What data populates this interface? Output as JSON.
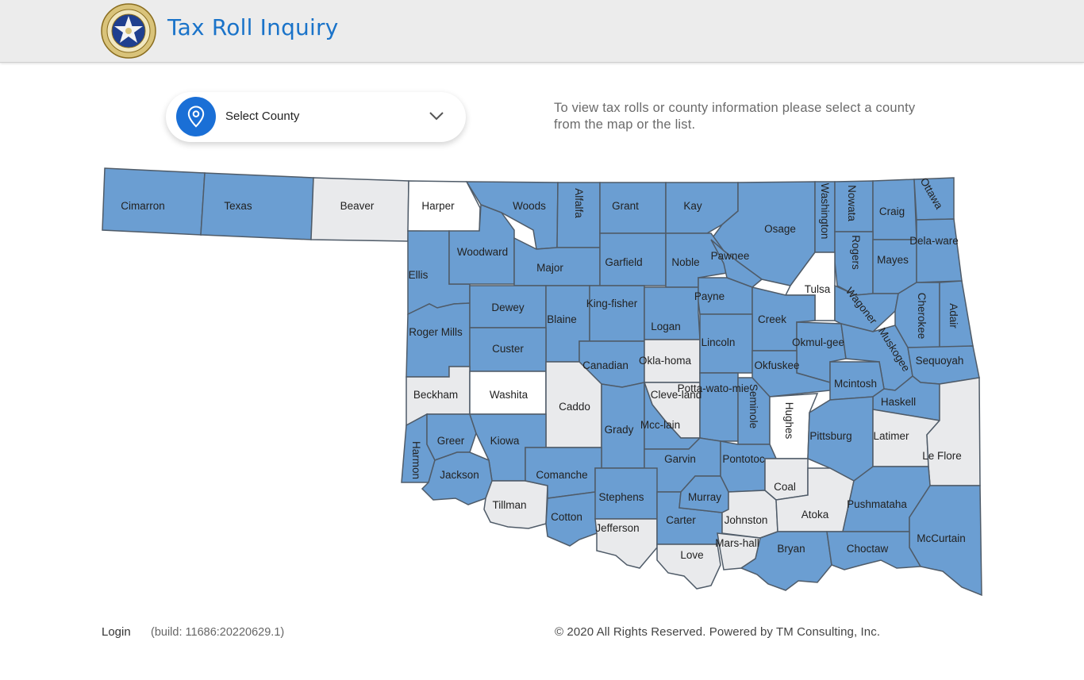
{
  "header": {
    "title": "Tax Roll Inquiry",
    "seal_icon": "state-seal-icon"
  },
  "county_select": {
    "label": "Select County",
    "icon": "map-pin-icon",
    "chevron_icon": "chevron-down-icon"
  },
  "instructions": {
    "line1": "To view tax rolls or county information please select a county",
    "line2": "from the map or the list."
  },
  "colors": {
    "accent": "#1a73c9",
    "county_available": "#6b9ed2",
    "county_unavailable": "#e9eaec",
    "county_selected_white": "#ffffff",
    "county_border": "#4f5b68"
  },
  "counties": [
    {
      "id": "cimarron",
      "name": "Cimarron"
    },
    {
      "id": "texas",
      "name": "Texas"
    },
    {
      "id": "beaver",
      "name": "Beaver"
    },
    {
      "id": "harper",
      "name": "Harper"
    },
    {
      "id": "woods",
      "name": "Woods"
    },
    {
      "id": "alfalfa",
      "name": "Alfalfa"
    },
    {
      "id": "grant",
      "name": "Grant"
    },
    {
      "id": "kay",
      "name": "Kay"
    },
    {
      "id": "osage",
      "name": "Osage"
    },
    {
      "id": "washington",
      "name": "Washington"
    },
    {
      "id": "nowata",
      "name": "Nowata"
    },
    {
      "id": "craig",
      "name": "Craig"
    },
    {
      "id": "ottawa",
      "name": "Ottawa"
    },
    {
      "id": "ellis",
      "name": "Ellis"
    },
    {
      "id": "woodward",
      "name": "Woodward"
    },
    {
      "id": "major",
      "name": "Major"
    },
    {
      "id": "garfield",
      "name": "Garfield"
    },
    {
      "id": "noble",
      "name": "Noble"
    },
    {
      "id": "pawnee",
      "name": "Pawnee"
    },
    {
      "id": "rogers",
      "name": "Rogers"
    },
    {
      "id": "mayes",
      "name": "Mayes"
    },
    {
      "id": "delaware",
      "name": "Dela-ware"
    },
    {
      "id": "tulsa",
      "name": "Tulsa"
    },
    {
      "id": "roger-mills",
      "name": "Roger Mills"
    },
    {
      "id": "dewey",
      "name": "Dewey"
    },
    {
      "id": "blaine",
      "name": "Blaine"
    },
    {
      "id": "kingfisher",
      "name": "King-fisher"
    },
    {
      "id": "logan",
      "name": "Logan"
    },
    {
      "id": "payne",
      "name": "Payne"
    },
    {
      "id": "creek",
      "name": "Creek"
    },
    {
      "id": "wagoner",
      "name": "Wagoner"
    },
    {
      "id": "cherokee",
      "name": "Cherokee"
    },
    {
      "id": "adair",
      "name": "Adair"
    },
    {
      "id": "custer",
      "name": "Custer"
    },
    {
      "id": "canadian",
      "name": "Canadian"
    },
    {
      "id": "oklahoma",
      "name": "Okla-homa"
    },
    {
      "id": "lincoln",
      "name": "Lincoln"
    },
    {
      "id": "okmulgee",
      "name": "Okmul-gee"
    },
    {
      "id": "okfuskee",
      "name": "Okfuskee"
    },
    {
      "id": "muskogee",
      "name": "Muskogee"
    },
    {
      "id": "sequoyah",
      "name": "Sequoyah"
    },
    {
      "id": "beckham",
      "name": "Beckham"
    },
    {
      "id": "washita",
      "name": "Washita"
    },
    {
      "id": "caddo",
      "name": "Caddo"
    },
    {
      "id": "cleveland",
      "name": "Cleve-land"
    },
    {
      "id": "pottawatomie",
      "name": "Potta-wato-mie"
    },
    {
      "id": "seminole",
      "name": "Seminole"
    },
    {
      "id": "hughes",
      "name": "Hughes"
    },
    {
      "id": "mcintosh",
      "name": "Mcintosh"
    },
    {
      "id": "haskell",
      "name": "Haskell"
    },
    {
      "id": "harmon",
      "name": "Harmon"
    },
    {
      "id": "greer",
      "name": "Greer"
    },
    {
      "id": "kiowa",
      "name": "Kiowa"
    },
    {
      "id": "grady",
      "name": "Grady"
    },
    {
      "id": "mcclain",
      "name": "Mcc-lain"
    },
    {
      "id": "garvin",
      "name": "Garvin"
    },
    {
      "id": "pontotoc",
      "name": "Pontotoc"
    },
    {
      "id": "pittsburg",
      "name": "Pittsburg"
    },
    {
      "id": "latimer",
      "name": "Latimer"
    },
    {
      "id": "le-flore",
      "name": "Le Flore"
    },
    {
      "id": "jackson",
      "name": "Jackson"
    },
    {
      "id": "tillman",
      "name": "Tillman"
    },
    {
      "id": "comanche",
      "name": "Comanche"
    },
    {
      "id": "cotton",
      "name": "Cotton"
    },
    {
      "id": "stephens",
      "name": "Stephens"
    },
    {
      "id": "jefferson",
      "name": "Jefferson"
    },
    {
      "id": "carter",
      "name": "Carter"
    },
    {
      "id": "murray",
      "name": "Murray"
    },
    {
      "id": "johnston",
      "name": "Johnston"
    },
    {
      "id": "coal",
      "name": "Coal"
    },
    {
      "id": "atoka",
      "name": "Atoka"
    },
    {
      "id": "pushmataha",
      "name": "Pushmataha"
    },
    {
      "id": "mccurtain",
      "name": "McCurtain"
    },
    {
      "id": "love",
      "name": "Love"
    },
    {
      "id": "marshall",
      "name": "Mars-hall"
    },
    {
      "id": "bryan",
      "name": "Bryan"
    },
    {
      "id": "choctaw",
      "name": "Choctaw"
    }
  ],
  "footer": {
    "login": "Login",
    "build": "(build: 11686:20220629.1)",
    "copyright": "© 2020 All Rights Reserved. Powered by TM Consulting, Inc."
  }
}
